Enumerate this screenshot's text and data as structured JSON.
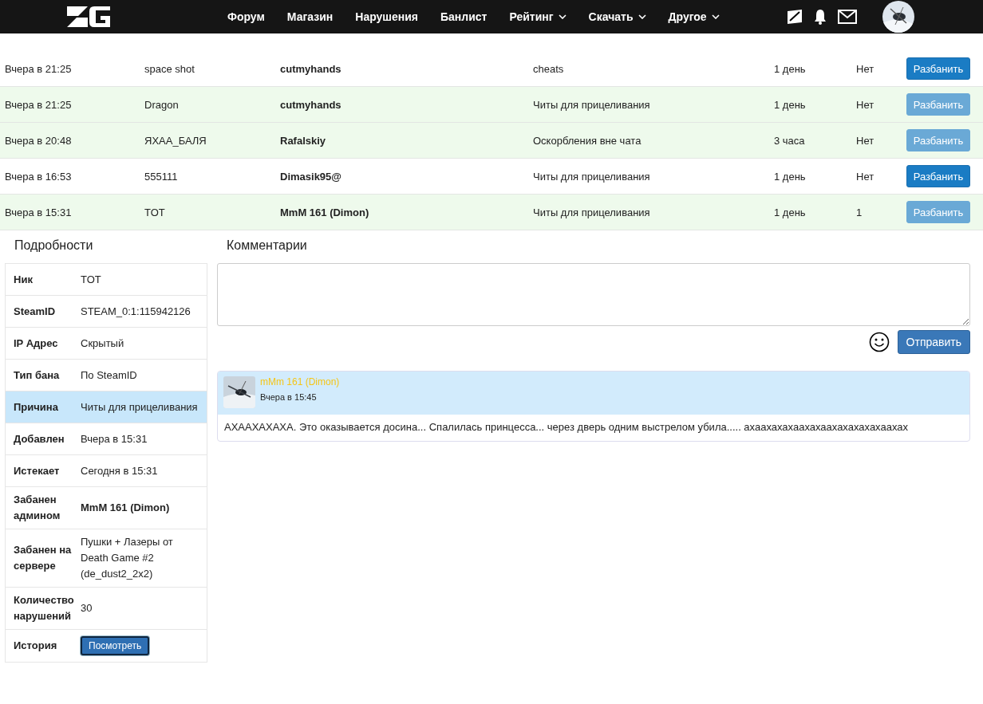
{
  "nav": {
    "items": [
      {
        "label": "Форум",
        "dropdown": false
      },
      {
        "label": "Магазин",
        "dropdown": false
      },
      {
        "label": "Нарушения",
        "dropdown": false
      },
      {
        "label": "Банлист",
        "dropdown": false
      },
      {
        "label": "Рейтинг",
        "dropdown": true
      },
      {
        "label": "Скачать",
        "dropdown": true
      },
      {
        "label": "Другое",
        "dropdown": true
      }
    ]
  },
  "bans": [
    {
      "date": "Вчера в 21:25",
      "player": "space shot",
      "admin": "cutmyhands",
      "reason": "cheats",
      "term": "1 день",
      "column_6": "Нет",
      "button": "Разбанить",
      "expired": false
    },
    {
      "date": "Вчера в 21:25",
      "player": "Dragon",
      "admin": "cutmyhands",
      "reason": "Читы для прицеливания",
      "term": "1 день",
      "column_6": "Нет",
      "button": "Разбанить",
      "expired": true
    },
    {
      "date": "Вчера в 20:48",
      "player": "ЯХАА_БАЛЯ",
      "admin": "Rafalskiy",
      "reason": "Оскорбления вне чата",
      "term": "3 часа",
      "column_6": "Нет",
      "button": "Разбанить",
      "expired": true
    },
    {
      "date": "Вчера в 16:53",
      "player": "555111",
      "admin": "Dimasik95@",
      "reason": "Читы для прицеливания",
      "term": "1 день",
      "column_6": "Нет",
      "button": "Разбанить",
      "expired": false
    },
    {
      "date": "Вчера в 15:31",
      "player": "TOT",
      "admin": "MmM 161 (Dimon)",
      "reason": "Читы для прицеливания",
      "term": "1 день",
      "column_6": "1",
      "button": "Разбанить",
      "expired": true
    }
  ],
  "details": {
    "title": "Подробности",
    "rows": [
      {
        "label": "Ник",
        "value": "TOT",
        "kind": "text",
        "selected": false
      },
      {
        "label": "SteamID",
        "value": "STEAM_0:1:115942126",
        "kind": "text",
        "selected": false
      },
      {
        "label": "IP Адрес",
        "value": "Скрытый",
        "kind": "text",
        "selected": false
      },
      {
        "label": "Тип бана",
        "value": "По SteamID",
        "kind": "text",
        "selected": false
      },
      {
        "label": "Причина",
        "value": "Читы для прицеливания",
        "kind": "text",
        "selected": true
      },
      {
        "label": "Добавлен",
        "value": "Вчера в 15:31",
        "kind": "text",
        "selected": false
      },
      {
        "label": "Истекает",
        "value": "Сегодня в 15:31",
        "kind": "text",
        "selected": false
      },
      {
        "label": "Забанен админом",
        "value": "MmM 161 (Dimon)",
        "kind": "bold",
        "selected": false
      },
      {
        "label": "Забанен на сервере",
        "value": "Пушки + Лазеры от Death Game #2 (de_dust2_2x2)",
        "kind": "text",
        "selected": false
      },
      {
        "label": "Количество нарушений",
        "value": "30",
        "kind": "text",
        "selected": false
      },
      {
        "label": "История",
        "value": "Посмотреть",
        "kind": "button",
        "selected": false
      }
    ]
  },
  "comments": {
    "title": "Комментарии",
    "send": "Отправить",
    "items": [
      {
        "author": "mMm 161 (Dimon)",
        "time": "Вчера в 15:45",
        "text": "АХААХАХАХА. Это оказывается досина... Спалилась принцесса... через дверь одним выстрелом убила..... ахаахахахаахахаахахахахахаахах"
      }
    ]
  }
}
